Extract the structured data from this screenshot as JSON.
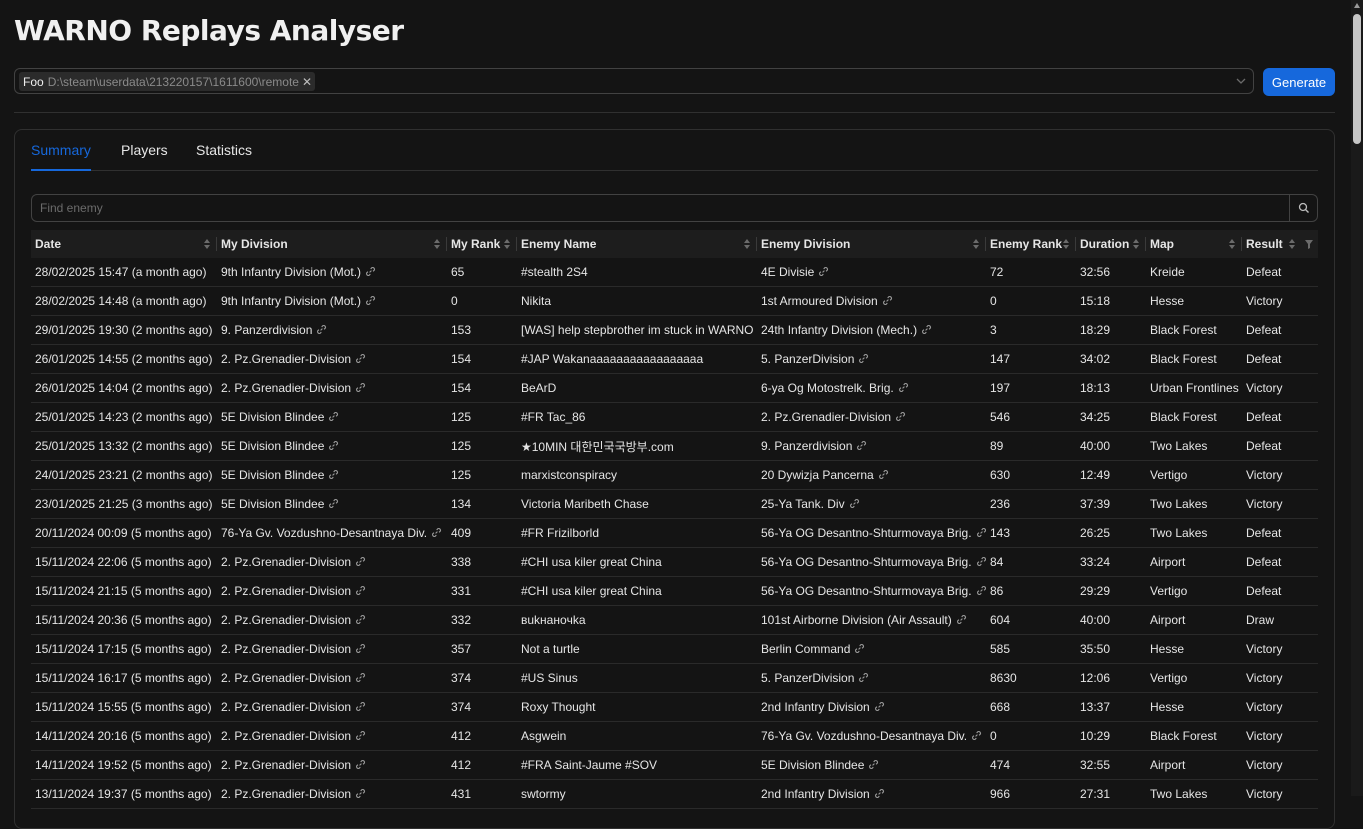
{
  "app": {
    "title": "WARNO Replays Analyser"
  },
  "selector": {
    "tag_name": "Foo",
    "tag_path": "D:\\steam\\userdata\\213220157\\1611600\\remote",
    "generate_label": "Generate"
  },
  "tabs": [
    {
      "label": "Summary",
      "active": true
    },
    {
      "label": "Players",
      "active": false
    },
    {
      "label": "Statistics",
      "active": false
    }
  ],
  "search": {
    "placeholder": "Find enemy"
  },
  "table": {
    "columns": [
      "Date",
      "My Division",
      "My Rank",
      "Enemy Name",
      "Enemy Division",
      "Enemy Rank",
      "Duration",
      "Map",
      "Result"
    ],
    "rows": [
      [
        "28/02/2025 15:47 (a month ago)",
        "9th Infantry Division (Mot.)",
        "65",
        "#stealth 2S4",
        "4E Divisie",
        "72",
        "32:56",
        "Kreide",
        "Defeat"
      ],
      [
        "28/02/2025 14:48 (a month ago)",
        "9th Infantry Division (Mot.)",
        "0",
        "Nikita",
        "1st Armoured Division",
        "0",
        "15:18",
        "Hesse",
        "Victory"
      ],
      [
        "29/01/2025 19:30 (2 months ago)",
        "9. Panzerdivision",
        "153",
        "[WAS] help stepbrother im stuck in WARNO",
        "24th Infantry Division (Mech.)",
        "3",
        "18:29",
        "Black Forest",
        "Defeat"
      ],
      [
        "26/01/2025 14:55 (2 months ago)",
        "2. Pz.Grenadier-Division",
        "154",
        "#JAP Wakanaaaaaaaaaaaaaaaaa",
        "5. PanzerDivision",
        "147",
        "34:02",
        "Black Forest",
        "Defeat"
      ],
      [
        "26/01/2025 14:04 (2 months ago)",
        "2. Pz.Grenadier-Division",
        "154",
        "BeArD",
        "6-ya Og Motostrelk. Brig.",
        "197",
        "18:13",
        "Urban Frontlines",
        "Victory"
      ],
      [
        "25/01/2025 14:23 (2 months ago)",
        "5E Division Blindee",
        "125",
        "#FR Tac_86",
        "2. Pz.Grenadier-Division",
        "546",
        "34:25",
        "Black Forest",
        "Defeat"
      ],
      [
        "25/01/2025 13:32 (2 months ago)",
        "5E Division Blindee",
        "125",
        "★10MIN 대한민국국방부.com",
        "9. Panzerdivision",
        "89",
        "40:00",
        "Two Lakes",
        "Defeat"
      ],
      [
        "24/01/2025 23:21 (2 months ago)",
        "5E Division Blindee",
        "125",
        "marxistconspiracy",
        "20 Dywizja Pancerna",
        "630",
        "12:49",
        "Vertigo",
        "Victory"
      ],
      [
        "23/01/2025 21:25 (3 months ago)",
        "5E Division Blindee",
        "134",
        "Victoria Maribeth Chase",
        "25-Ya Tank. Div",
        "236",
        "37:39",
        "Two Lakes",
        "Victory"
      ],
      [
        "20/11/2024 00:09 (5 months ago)",
        "76-Ya Gv. Vozdushno-Desantnaya Div.",
        "409",
        "#FR Frizilborld",
        "56-Ya OG Desantno-Shturmovaya Brig.",
        "143",
        "26:25",
        "Two Lakes",
        "Defeat"
      ],
      [
        "15/11/2024 22:06 (5 months ago)",
        "2. Pz.Grenadier-Division",
        "338",
        "#CHI usa kiler great China",
        "56-Ya OG Desantno-Shturmovaya Brig.",
        "84",
        "33:24",
        "Airport",
        "Defeat"
      ],
      [
        "15/11/2024 21:15 (5 months ago)",
        "2. Pz.Grenadier-Division",
        "331",
        "#CHI usa kiler great China",
        "56-Ya OG Desantno-Shturmovaya Brig.",
        "86",
        "29:29",
        "Vertigo",
        "Defeat"
      ],
      [
        "15/11/2024 20:36 (5 months ago)",
        "2. Pz.Grenadier-Division",
        "332",
        "вukнaнoчka",
        "101st Airborne Division (Air Assault)",
        "604",
        "40:00",
        "Airport",
        "Draw"
      ],
      [
        "15/11/2024 17:15 (5 months ago)",
        "2. Pz.Grenadier-Division",
        "357",
        "Not a turtle",
        "Berlin Command",
        "585",
        "35:50",
        "Hesse",
        "Victory"
      ],
      [
        "15/11/2024 16:17 (5 months ago)",
        "2. Pz.Grenadier-Division",
        "374",
        "#US Sinus",
        "5. PanzerDivision",
        "8630",
        "12:06",
        "Vertigo",
        "Victory"
      ],
      [
        "15/11/2024 15:55 (5 months ago)",
        "2. Pz.Grenadier-Division",
        "374",
        "Roxy Thought",
        "2nd Infantry Division",
        "668",
        "13:37",
        "Hesse",
        "Victory"
      ],
      [
        "14/11/2024 20:16 (5 months ago)",
        "2. Pz.Grenadier-Division",
        "412",
        "Asgwein",
        "76-Ya Gv. Vozdushno-Desantnaya Div.",
        "0",
        "10:29",
        "Black Forest",
        "Victory"
      ],
      [
        "14/11/2024 19:52 (5 months ago)",
        "2. Pz.Grenadier-Division",
        "412",
        "#FRA Saint-Jaume #SOV",
        "5E Division Blindee",
        "474",
        "32:55",
        "Airport",
        "Victory"
      ],
      [
        "13/11/2024 19:37 (5 months ago)",
        "2. Pz.Grenadier-Division",
        "431",
        "swtormy",
        "2nd Infantry Division",
        "966",
        "27:31",
        "Two Lakes",
        "Victory"
      ]
    ]
  }
}
